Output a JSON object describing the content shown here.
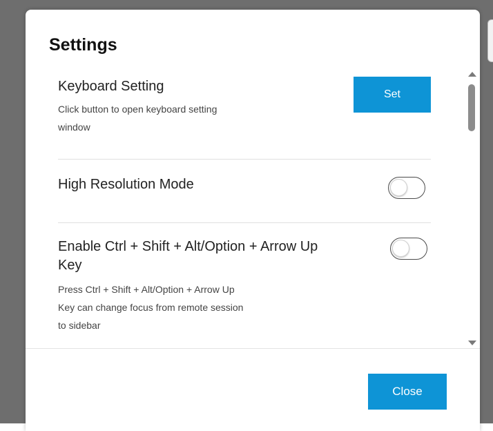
{
  "dialog": {
    "title": "Settings",
    "close_label": "Close"
  },
  "settings": [
    {
      "title": "Keyboard Setting",
      "description_lines": [
        "Click button to open keyboard setting",
        "window"
      ],
      "action_label": "Set"
    },
    {
      "title": "High Resolution Mode",
      "toggle_on": false
    },
    {
      "title_lines": [
        "Enable Ctrl + Shift + Alt/Option + Arrow Up",
        "Key"
      ],
      "description_lines": [
        "Press Ctrl + Shift + Alt/Option + Arrow Up",
        "Key can change focus from remote session",
        "to sidebar"
      ],
      "toggle_on": false
    }
  ],
  "colors": {
    "accent": "#0e94d6",
    "backdrop": "#6e6e6e"
  },
  "icons": {
    "scroll_up": "triangle-up-icon",
    "scroll_down": "triangle-down-icon"
  }
}
